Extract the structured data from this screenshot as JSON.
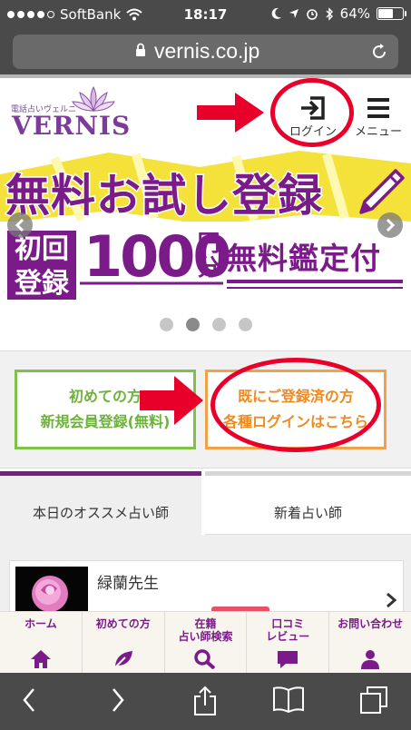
{
  "status_bar": {
    "carrier": "SoftBank",
    "time": "18:17",
    "battery": "64%",
    "battery_level": 0.64
  },
  "browser": {
    "url": "vernis.co.jp"
  },
  "site_header": {
    "logo_subtitle": "電話占いヴェルニ",
    "logo_text": "VERNIS",
    "login_label": "ログイン",
    "menu_label": "メニュー"
  },
  "banner": {
    "title": "無料お試し登録",
    "first_registration": [
      "初回",
      "登録"
    ],
    "amount": "1000",
    "amount_unit": [
      "円",
      "分"
    ],
    "free_appraisal": "無料鑑定付",
    "slide_count": 4,
    "active_slide": 2
  },
  "cta": {
    "new_member": {
      "line1": "初めての方",
      "line2": "新規会員登録(無料)"
    },
    "existing_member": {
      "line1": "既にご登録済の方",
      "line2": "各種ログインはこちら"
    }
  },
  "tabs": [
    {
      "label": "本日のオススメ占い師",
      "active": true
    },
    {
      "label": "新着占い師",
      "active": false
    }
  ],
  "fortune_teller": {
    "name": "緑蘭先生"
  },
  "site_nav": [
    {
      "label": "ホーム",
      "icon": "home-icon"
    },
    {
      "label": "初めての方",
      "icon": "leaf-icon"
    },
    {
      "label": "在籍\n占い師検索",
      "icon": "search-icon"
    },
    {
      "label": "口コミ\nレビュー",
      "icon": "speech-bubble-icon"
    },
    {
      "label": "お問い合わせ",
      "icon": "person-icon"
    }
  ],
  "colors": {
    "brand_purple": "#7b1b8a",
    "annotation_red": "#e8002a",
    "cta_green": "#6db33b",
    "cta_orange": "#ef8a20"
  }
}
